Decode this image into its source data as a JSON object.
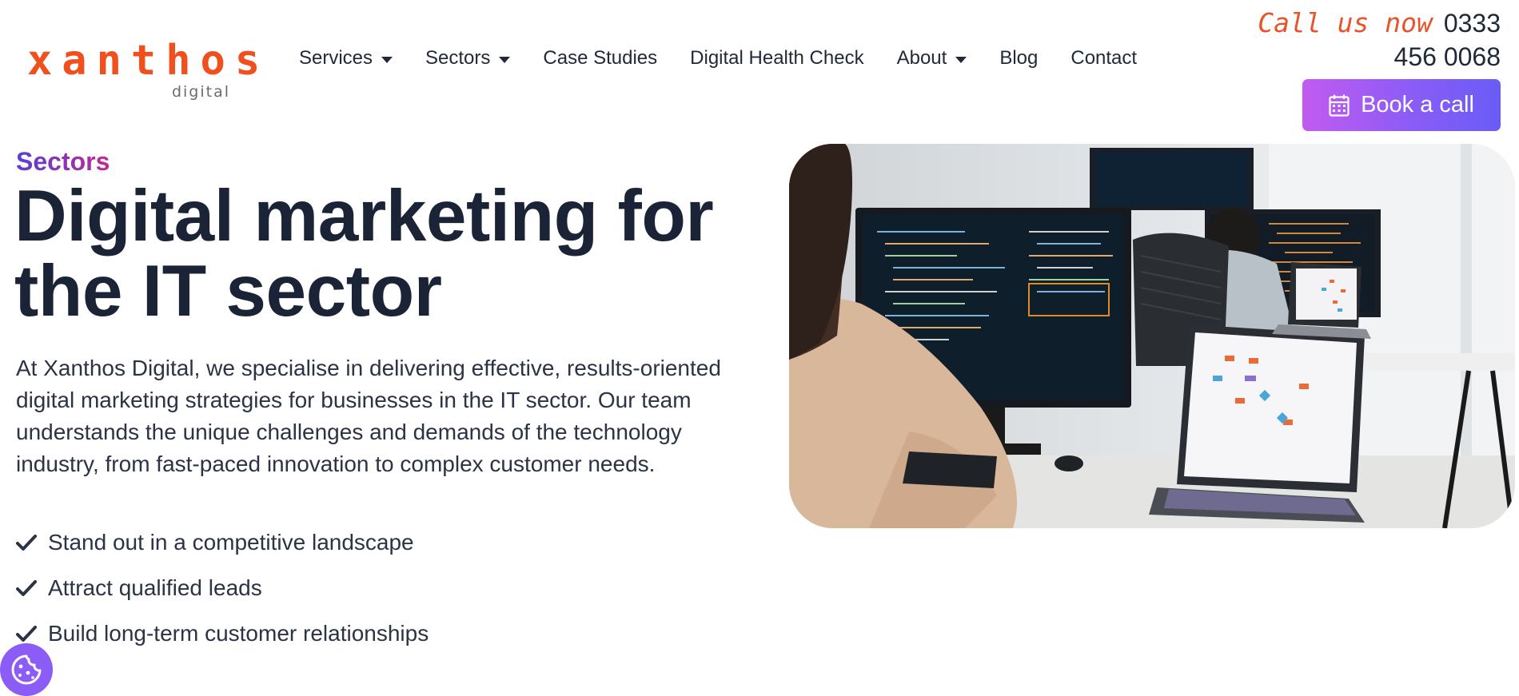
{
  "brand": {
    "name": "xanthos",
    "sub": "digital",
    "accent_color": "#f0501e"
  },
  "nav": {
    "items": [
      {
        "label": "Services",
        "dropdown": true
      },
      {
        "label": "Sectors",
        "dropdown": true
      },
      {
        "label": "Case Studies",
        "dropdown": false
      },
      {
        "label": "Digital Health Check",
        "dropdown": false
      },
      {
        "label": "About",
        "dropdown": true
      },
      {
        "label": "Blog",
        "dropdown": false
      },
      {
        "label": "Contact",
        "dropdown": false
      }
    ]
  },
  "call": {
    "label": "Call us now",
    "number_line1": "0333",
    "number_line2": "456 0068"
  },
  "cta": {
    "book_label": "Book a call",
    "icon": "calendar-icon",
    "gradient_start": "#c25bf0",
    "gradient_end": "#6a5cf7"
  },
  "hero": {
    "eyebrow": "Sectors",
    "title_line1": "Digital marketing for",
    "title_line2": "the IT sector",
    "description": "At Xanthos Digital, we specialise in delivering effective, results-oriented digital marketing strategies for businesses in the IT sector. Our team understands the unique challenges and demands of the technology industry, from fast-paced innovation to complex customer needs.",
    "benefits": [
      "Stand out in a competitive landscape",
      "Attract qualified leads",
      "Build long-term customer relationships"
    ],
    "image": "photo-developers-at-monitors"
  },
  "cookie": {
    "icon": "cookie-icon",
    "color": "#8b5cf6"
  }
}
